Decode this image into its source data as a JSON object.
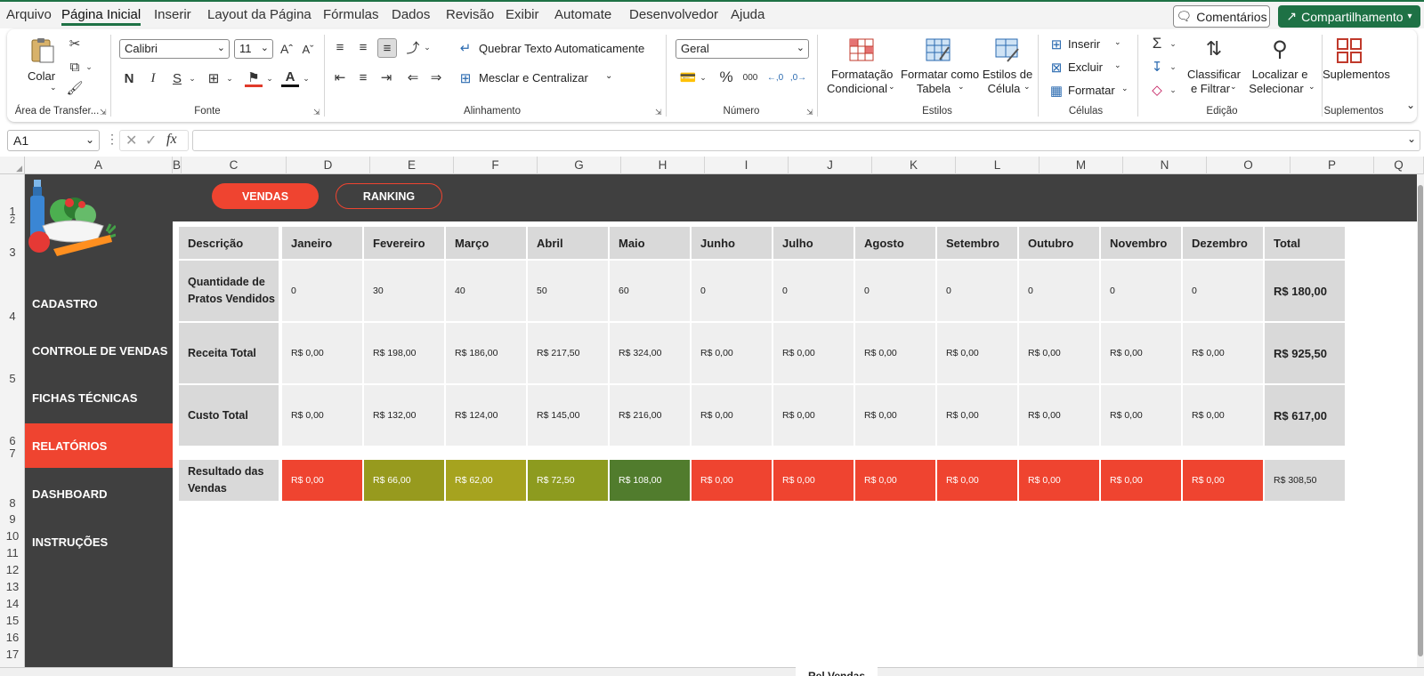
{
  "menu": {
    "tabs": [
      "Arquivo",
      "Página Inicial",
      "Inserir",
      "Layout da Página",
      "Fórmulas",
      "Dados",
      "Revisão",
      "Exibir",
      "Automate",
      "Desenvolvedor",
      "Ajuda"
    ],
    "comments_label": "Comentários",
    "share_label": "Compartilhamento"
  },
  "ribbon": {
    "clipboard": {
      "paste_label": "Colar",
      "group_label": "Área de Transfer..."
    },
    "font": {
      "name": "Calibri",
      "size": "11",
      "bold": "N",
      "italic": "I",
      "underline": "S",
      "group_label": "Fonte"
    },
    "alignment": {
      "wrap_text": "Quebrar Texto Automaticamente",
      "merge_center": "Mesclar e Centralizar",
      "group_label": "Alinhamento"
    },
    "number": {
      "format": "Geral",
      "group_label": "Número"
    },
    "styles": {
      "conditional_1": "Formatação",
      "conditional_2": "Condicional",
      "table_1": "Formatar como",
      "table_2": "Tabela",
      "cell_1": "Estilos de",
      "cell_2": "Célula",
      "group_label": "Estilos"
    },
    "cells": {
      "insert": "Inserir",
      "delete": "Excluir",
      "format": "Formatar",
      "group_label": "Células"
    },
    "editing": {
      "sort_1": "Classificar",
      "sort_2": "e Filtrar",
      "find_1": "Localizar e",
      "find_2": "Selecionar",
      "group_label": "Edição"
    },
    "addins": {
      "label": "Suplementos",
      "group_label": "Suplementos"
    }
  },
  "formula_bar": {
    "name_box": "A1",
    "fx": "fx",
    "formula": ""
  },
  "columns": [
    "A",
    "B",
    "C",
    "D",
    "E",
    "F",
    "G",
    "H",
    "I",
    "J",
    "K",
    "L",
    "M",
    "N",
    "O",
    "P",
    "Q"
  ],
  "rows": [
    "1",
    "2",
    "3",
    "4",
    "5",
    "6",
    "7",
    "8",
    "9",
    "10",
    "11",
    "12",
    "13",
    "14",
    "15",
    "16",
    "17"
  ],
  "top_buttons": {
    "vendas": "VENDAS",
    "ranking": "RANKING"
  },
  "sidebar": [
    "CADASTRO",
    "CONTROLE DE VENDAS",
    "FICHAS TÉCNICAS",
    "RELATÓRIOS",
    "DASHBOARD",
    "INSTRUÇÕES"
  ],
  "table": {
    "headers": [
      "Descrição",
      "Janeiro",
      "Fevereiro",
      "Março",
      "Abril",
      "Maio",
      "Junho",
      "Julho",
      "Agosto",
      "Setembro",
      "Outubro",
      "Novembro",
      "Dezembro",
      "Total"
    ],
    "rows": [
      {
        "label": "Quantidade de Pratos Vendidos",
        "values": [
          "0",
          "30",
          "40",
          "50",
          "60",
          "0",
          "0",
          "0",
          "0",
          "0",
          "0",
          "0"
        ],
        "total": "R$ 180,00"
      },
      {
        "label": "Receita Total",
        "values": [
          "R$ 0,00",
          "R$ 198,00",
          "R$ 186,00",
          "R$ 217,50",
          "R$ 324,00",
          "R$ 0,00",
          "R$ 0,00",
          "R$ 0,00",
          "R$ 0,00",
          "R$ 0,00",
          "R$ 0,00",
          "R$ 0,00"
        ],
        "total": "R$ 925,50"
      },
      {
        "label": "Custo Total",
        "values": [
          "R$ 0,00",
          "R$ 132,00",
          "R$ 124,00",
          "R$ 145,00",
          "R$ 216,00",
          "R$ 0,00",
          "R$ 0,00",
          "R$ 0,00",
          "R$ 0,00",
          "R$ 0,00",
          "R$ 0,00",
          "R$ 0,00"
        ],
        "total": "R$ 617,00"
      }
    ],
    "result": {
      "label": "Resultado das Vendas",
      "values": [
        "R$ 0,00",
        "R$ 66,00",
        "R$ 62,00",
        "R$ 72,50",
        "R$ 108,00",
        "R$ 0,00",
        "R$ 0,00",
        "R$ 0,00",
        "R$ 0,00",
        "R$ 0,00",
        "R$ 0,00",
        "R$ 0,00"
      ],
      "colors": [
        "#ef4430",
        "#979a1e",
        "#a6a31f",
        "#8d9b1f",
        "#517c2d",
        "#ef4430",
        "#ef4430",
        "#ef4430",
        "#ef4430",
        "#ef4430",
        "#ef4430",
        "#ef4430"
      ],
      "total": "R$ 308,50"
    }
  },
  "sheet_tab": "Rel.Vendas",
  "colors": {
    "accent": "#ef4430",
    "dark": "#404040",
    "excel_green": "#1e7145"
  }
}
